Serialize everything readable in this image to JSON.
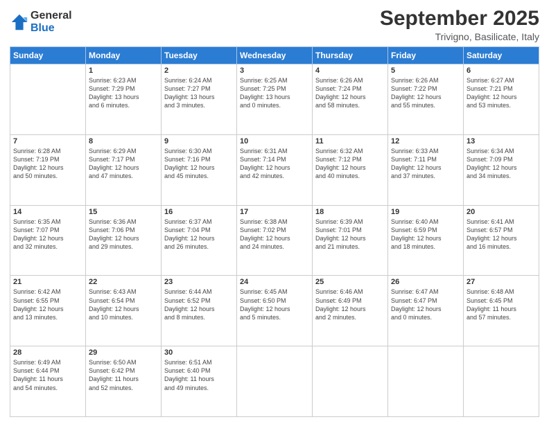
{
  "logo": {
    "line1": "General",
    "line2": "Blue"
  },
  "title": "September 2025",
  "subtitle": "Trivigno, Basilicate, Italy",
  "days_of_week": [
    "Sunday",
    "Monday",
    "Tuesday",
    "Wednesday",
    "Thursday",
    "Friday",
    "Saturday"
  ],
  "weeks": [
    [
      {
        "day": "",
        "info": ""
      },
      {
        "day": "1",
        "info": "Sunrise: 6:23 AM\nSunset: 7:29 PM\nDaylight: 13 hours\nand 6 minutes."
      },
      {
        "day": "2",
        "info": "Sunrise: 6:24 AM\nSunset: 7:27 PM\nDaylight: 13 hours\nand 3 minutes."
      },
      {
        "day": "3",
        "info": "Sunrise: 6:25 AM\nSunset: 7:25 PM\nDaylight: 13 hours\nand 0 minutes."
      },
      {
        "day": "4",
        "info": "Sunrise: 6:26 AM\nSunset: 7:24 PM\nDaylight: 12 hours\nand 58 minutes."
      },
      {
        "day": "5",
        "info": "Sunrise: 6:26 AM\nSunset: 7:22 PM\nDaylight: 12 hours\nand 55 minutes."
      },
      {
        "day": "6",
        "info": "Sunrise: 6:27 AM\nSunset: 7:21 PM\nDaylight: 12 hours\nand 53 minutes."
      }
    ],
    [
      {
        "day": "7",
        "info": "Sunrise: 6:28 AM\nSunset: 7:19 PM\nDaylight: 12 hours\nand 50 minutes."
      },
      {
        "day": "8",
        "info": "Sunrise: 6:29 AM\nSunset: 7:17 PM\nDaylight: 12 hours\nand 47 minutes."
      },
      {
        "day": "9",
        "info": "Sunrise: 6:30 AM\nSunset: 7:16 PM\nDaylight: 12 hours\nand 45 minutes."
      },
      {
        "day": "10",
        "info": "Sunrise: 6:31 AM\nSunset: 7:14 PM\nDaylight: 12 hours\nand 42 minutes."
      },
      {
        "day": "11",
        "info": "Sunrise: 6:32 AM\nSunset: 7:12 PM\nDaylight: 12 hours\nand 40 minutes."
      },
      {
        "day": "12",
        "info": "Sunrise: 6:33 AM\nSunset: 7:11 PM\nDaylight: 12 hours\nand 37 minutes."
      },
      {
        "day": "13",
        "info": "Sunrise: 6:34 AM\nSunset: 7:09 PM\nDaylight: 12 hours\nand 34 minutes."
      }
    ],
    [
      {
        "day": "14",
        "info": "Sunrise: 6:35 AM\nSunset: 7:07 PM\nDaylight: 12 hours\nand 32 minutes."
      },
      {
        "day": "15",
        "info": "Sunrise: 6:36 AM\nSunset: 7:06 PM\nDaylight: 12 hours\nand 29 minutes."
      },
      {
        "day": "16",
        "info": "Sunrise: 6:37 AM\nSunset: 7:04 PM\nDaylight: 12 hours\nand 26 minutes."
      },
      {
        "day": "17",
        "info": "Sunrise: 6:38 AM\nSunset: 7:02 PM\nDaylight: 12 hours\nand 24 minutes."
      },
      {
        "day": "18",
        "info": "Sunrise: 6:39 AM\nSunset: 7:01 PM\nDaylight: 12 hours\nand 21 minutes."
      },
      {
        "day": "19",
        "info": "Sunrise: 6:40 AM\nSunset: 6:59 PM\nDaylight: 12 hours\nand 18 minutes."
      },
      {
        "day": "20",
        "info": "Sunrise: 6:41 AM\nSunset: 6:57 PM\nDaylight: 12 hours\nand 16 minutes."
      }
    ],
    [
      {
        "day": "21",
        "info": "Sunrise: 6:42 AM\nSunset: 6:55 PM\nDaylight: 12 hours\nand 13 minutes."
      },
      {
        "day": "22",
        "info": "Sunrise: 6:43 AM\nSunset: 6:54 PM\nDaylight: 12 hours\nand 10 minutes."
      },
      {
        "day": "23",
        "info": "Sunrise: 6:44 AM\nSunset: 6:52 PM\nDaylight: 12 hours\nand 8 minutes."
      },
      {
        "day": "24",
        "info": "Sunrise: 6:45 AM\nSunset: 6:50 PM\nDaylight: 12 hours\nand 5 minutes."
      },
      {
        "day": "25",
        "info": "Sunrise: 6:46 AM\nSunset: 6:49 PM\nDaylight: 12 hours\nand 2 minutes."
      },
      {
        "day": "26",
        "info": "Sunrise: 6:47 AM\nSunset: 6:47 PM\nDaylight: 12 hours\nand 0 minutes."
      },
      {
        "day": "27",
        "info": "Sunrise: 6:48 AM\nSunset: 6:45 PM\nDaylight: 11 hours\nand 57 minutes."
      }
    ],
    [
      {
        "day": "28",
        "info": "Sunrise: 6:49 AM\nSunset: 6:44 PM\nDaylight: 11 hours\nand 54 minutes."
      },
      {
        "day": "29",
        "info": "Sunrise: 6:50 AM\nSunset: 6:42 PM\nDaylight: 11 hours\nand 52 minutes."
      },
      {
        "day": "30",
        "info": "Sunrise: 6:51 AM\nSunset: 6:40 PM\nDaylight: 11 hours\nand 49 minutes."
      },
      {
        "day": "",
        "info": ""
      },
      {
        "day": "",
        "info": ""
      },
      {
        "day": "",
        "info": ""
      },
      {
        "day": "",
        "info": ""
      }
    ]
  ]
}
